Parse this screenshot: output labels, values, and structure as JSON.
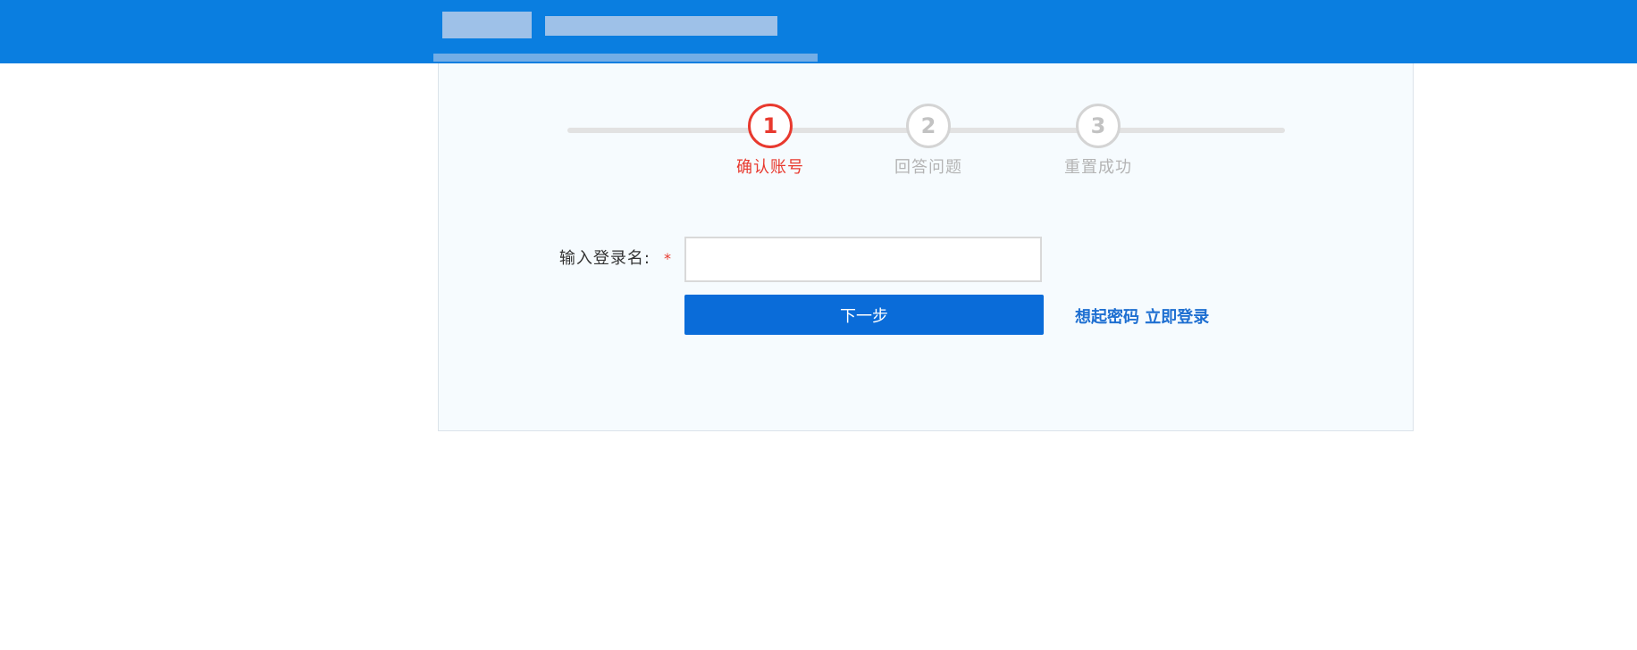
{
  "colors": {
    "header_bg": "#0a7ee0",
    "active_step": "#e8392e",
    "inactive_step": "#c2c2c2",
    "primary_button": "#0a6cd9",
    "link": "#1e6fd1"
  },
  "steps": [
    {
      "number": "1",
      "label": "确认账号",
      "active": true
    },
    {
      "number": "2",
      "label": "回答问题",
      "active": false
    },
    {
      "number": "3",
      "label": "重置成功",
      "active": false
    }
  ],
  "form": {
    "login_name_label": "输入登录名:",
    "required_mark": "*",
    "login_name_value": "",
    "next_button_label": "下一步",
    "remember_link": "想起密码 立即登录"
  }
}
